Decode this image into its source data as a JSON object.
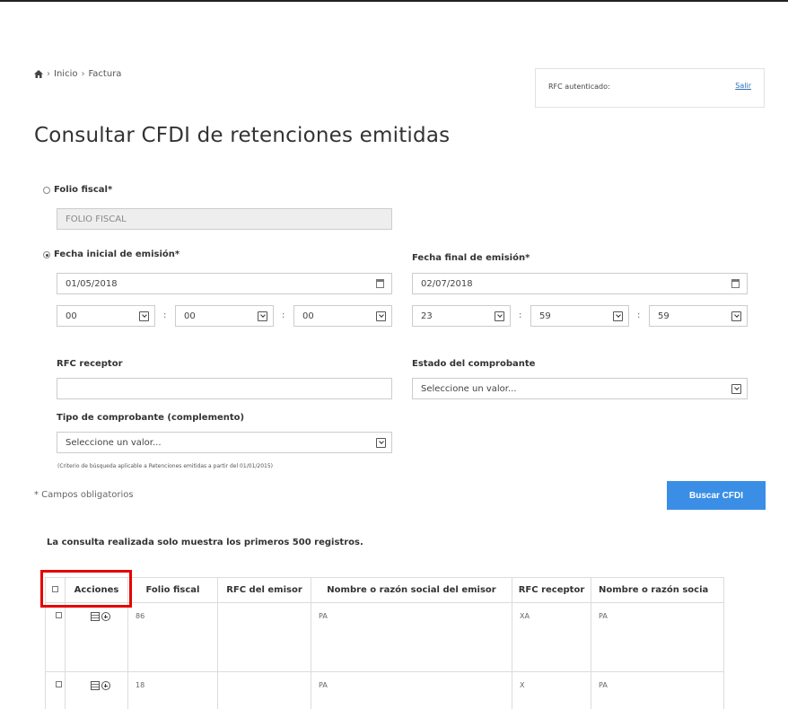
{
  "breadcrumb": {
    "home": "Inicio",
    "current": "Factura"
  },
  "session": {
    "rfc_label": "RFC autenticado:",
    "logout": "Salir"
  },
  "page": {
    "title": "Consultar CFDI de retenciones emitidas"
  },
  "form": {
    "folio": {
      "label": "Folio fiscal*",
      "placeholder": "FOLIO FISCAL",
      "selected": false
    },
    "fecha_inicial": {
      "label": "Fecha inicial de emisión*",
      "value": "01/05/2018",
      "hh": "00",
      "mm": "00",
      "ss": "00",
      "selected": true
    },
    "fecha_final": {
      "label": "Fecha final de emisión*",
      "value": "02/07/2018",
      "hh": "23",
      "mm": "59",
      "ss": "59"
    },
    "rfc_receptor": {
      "label": "RFC receptor",
      "value": ""
    },
    "estado": {
      "label": "Estado del comprobante",
      "value": "Seleccione un valor..."
    },
    "tipo": {
      "label": "Tipo de comprobante (complemento)",
      "value": "Seleccione un valor..."
    },
    "note": "(Criterio de búsqueda aplicable a Retenciones emitidas a partir del 01/01/2015)",
    "required": "* Campos obligatorios",
    "submit": "Buscar CFDI"
  },
  "results": {
    "notice": "La consulta realizada solo muestra los primeros 500 registros.",
    "columns": [
      "Acciones",
      "Folio fiscal",
      "RFC del emisor",
      "Nombre o razón social del emisor",
      "RFC receptor",
      "Nombre o razón socia"
    ],
    "rows": [
      {
        "folio": "86",
        "rfc_emisor": "",
        "nombre_emisor": "PA",
        "rfc_receptor": "XA",
        "nombre_receptor": "PA"
      },
      {
        "folio": "18",
        "rfc_emisor": "",
        "nombre_emisor": "PA",
        "rfc_receptor": "X",
        "nombre_receptor": "PA"
      }
    ]
  }
}
